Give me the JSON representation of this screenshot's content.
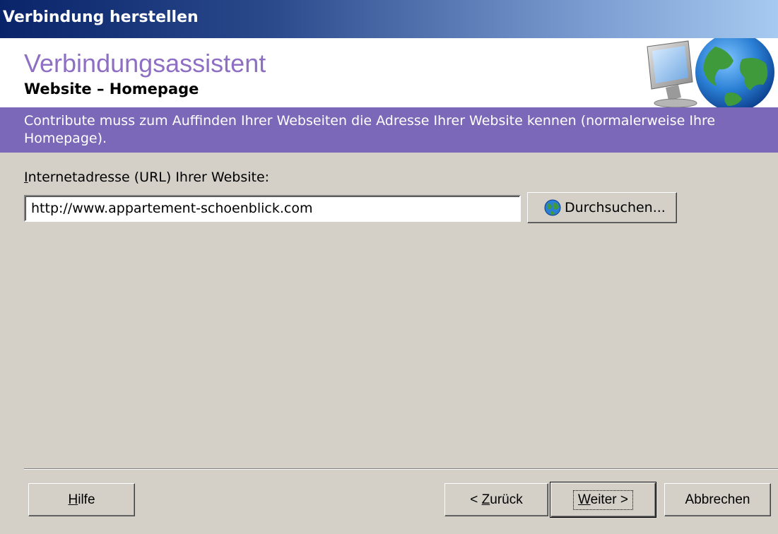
{
  "window": {
    "title": "Verbindung herstellen"
  },
  "header": {
    "title": "Verbindungsassistent",
    "subtitle": "Website – Homepage",
    "graphic_icon": "monitor-globe-icon"
  },
  "info": {
    "text": "Contribute muss zum Auffinden Ihrer Webseiten die Adresse Ihrer Website kennen (normalerweise Ihre Homepage)."
  },
  "url_field": {
    "label_access_key": "I",
    "label_rest": "nternetadresse (URL) Ihrer Website:",
    "value": "http://www.appartement-schoenblick.com"
  },
  "browse_button": {
    "label": "Durchsuchen...",
    "icon": "globe-icon"
  },
  "footer": {
    "help": {
      "access_key": "H",
      "rest": "ilfe"
    },
    "back": {
      "prefix": "< ",
      "access_key": "Z",
      "rest": "urück"
    },
    "next": {
      "access_key": "W",
      "rest": "eiter >"
    },
    "cancel": "Abbrechen"
  },
  "colors": {
    "titlebar_start": "#0a246a",
    "titlebar_end": "#a6caf0",
    "header_title": "#8e6fc4",
    "info_band": "#7b68b8",
    "dialog_bg": "#d4d0c8"
  }
}
